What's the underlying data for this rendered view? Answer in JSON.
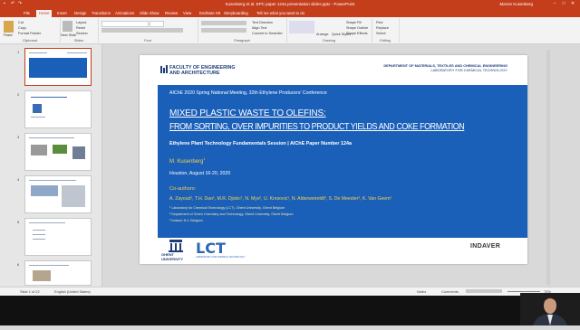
{
  "window": {
    "title": "Kusenberg et al. EPC paper 124a presentation slides.pptx  -  PowerPoint",
    "user": "Marvin Kusenberg",
    "colors": {
      "accent": "#c43e1c",
      "slide_blue": "#1a5fb8",
      "heading_navy": "#1f3c78"
    }
  },
  "tabs": [
    "File",
    "Home",
    "Insert",
    "Design",
    "Transitions",
    "Animations",
    "Slide Show",
    "Review",
    "View",
    "EndNote X9",
    "Storyboarding",
    "Tell me what you want to do"
  ],
  "ribbon": {
    "clipboard": {
      "label": "Clipboard",
      "paste": "Paste",
      "cut": "Cut",
      "copy": "Copy",
      "format_painter": "Format Painter"
    },
    "slides": {
      "label": "Slides",
      "new_slide": "New Slide",
      "layout": "Layout",
      "reset": "Reset",
      "section": "Section"
    },
    "font": {
      "label": "Font"
    },
    "paragraph": {
      "label": "Paragraph",
      "text_direction": "Text Direction",
      "align_text": "Align Text",
      "convert": "Convert to SmartArt"
    },
    "drawing": {
      "label": "Drawing",
      "arrange": "Arrange",
      "quick_styles": "Quick Styles",
      "shape_fill": "Shape Fill",
      "shape_outline": "Shape Outline",
      "shape_effects": "Shape Effects"
    },
    "editing": {
      "label": "Editing",
      "find": "Find",
      "replace": "Replace",
      "select": "Select"
    }
  },
  "thumbnails": [
    "1",
    "2",
    "3",
    "4",
    "5",
    "6"
  ],
  "slide": {
    "faculty": [
      "FACULTY OF ENGINEERING",
      "AND ARCHITECTURE"
    ],
    "department": [
      "DEPARTMENT OF MATERIALS, TEXTILES AND CHEMICAL ENGINEERING",
      "LABORATORY FOR CHEMICAL TECHNOLOGY"
    ],
    "conference": "AIChE 2020 Spring National Meeting, 32th Ethylene Producers' Conference",
    "title_line1": "MIXED PLASTIC WASTE TO OLEFINS:",
    "title_line2": "FROM SORTING, OVER IMPURITIES TO PRODUCT YIELDS AND COKE FORMATION",
    "session": "Ethylene Plant Technology Fundamentals Session | AIChE Paper Number 124a",
    "presenter": "M. Kusenberg",
    "presenter_sup": "1",
    "date": "Houston, August 16-20, 2020",
    "coauthors_label": "Co-authors:",
    "coauthors": "A. Zayoud¹, T.H. Dao¹, M.R. Djokic¹, N. Mys², U. Kresovic¹, N. Alderweireldt³, S. De Meester², K. Van Geem¹",
    "affiliations": [
      "¹ Laboratory for Chemical Technology (LCT), Ghent University, Ghent Belgium",
      "² Department of Green Chemistry and Technology, Ghent University, Ghent Belgium",
      "³ Indaver N.V. Belgium"
    ],
    "ghent_logo": [
      "GHENT",
      "UNIVERSITY"
    ],
    "lct_logo": "LCT",
    "lct_sub": "LABORATORY FOR CHEMICAL TECHNOLOGY",
    "indaver_logo": "INDAVER"
  },
  "status": {
    "slide_count": "Slide 1 of 22",
    "language": "English (United States)",
    "notes": "Notes",
    "comments": "Comments",
    "zoom": "73%"
  }
}
